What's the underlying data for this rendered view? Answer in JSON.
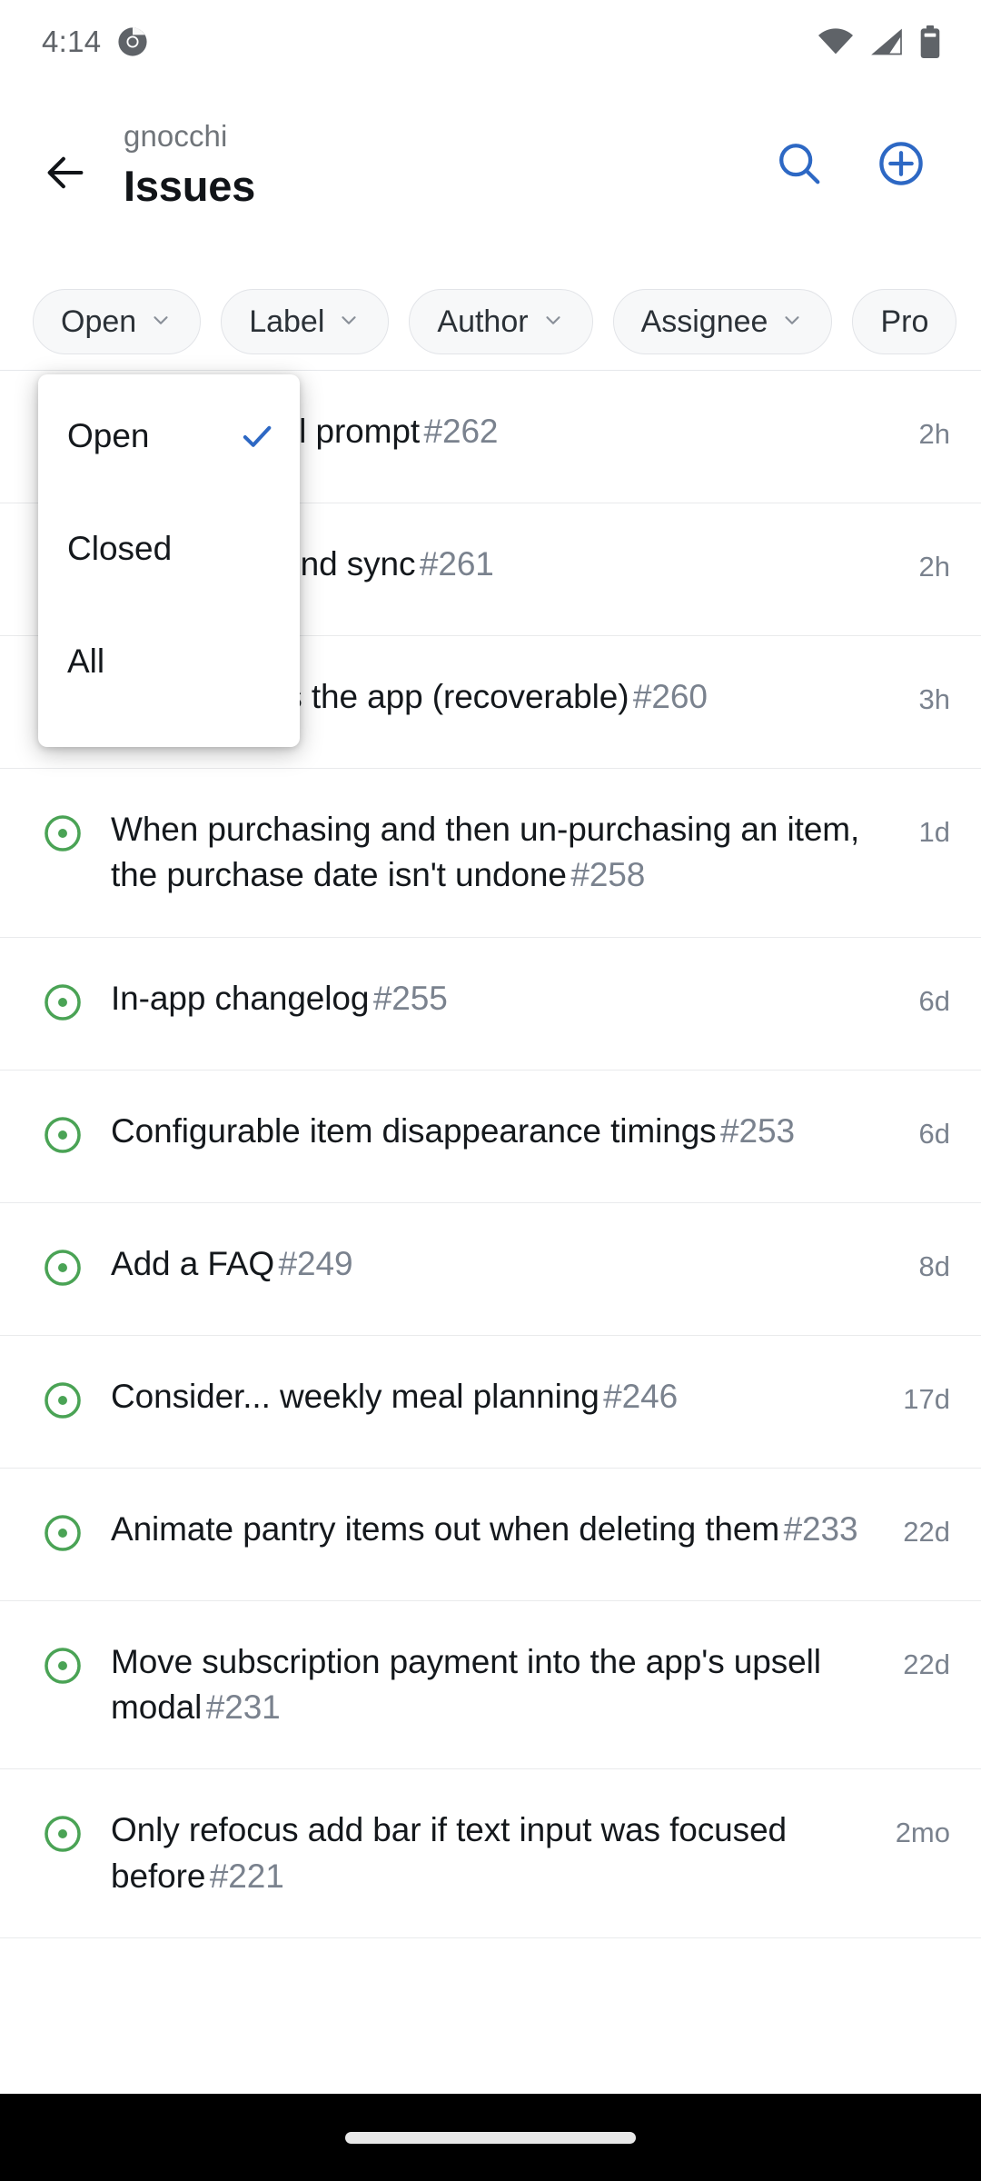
{
  "status_bar": {
    "time": "4:14",
    "browser_icon": "chrome-icon",
    "wifi_icon": "wifi-icon",
    "signal_icon": "cellular-signal-icon",
    "battery_icon": "battery-icon"
  },
  "app_bar": {
    "back_icon": "back-arrow-icon",
    "subtitle": "gnocchi",
    "title": "Issues",
    "search_icon": "search-icon",
    "add_icon": "plus-circle-icon"
  },
  "filters": [
    {
      "label": "Open",
      "chevron": "chevron-down-icon"
    },
    {
      "label": "Label",
      "chevron": "chevron-down-icon"
    },
    {
      "label": "Author",
      "chevron": "chevron-down-icon"
    },
    {
      "label": "Assignee",
      "chevron": "chevron-down-icon"
    },
    {
      "label": "Pro",
      "chevron": "chevron-down-icon"
    }
  ],
  "dropdown": {
    "open": true,
    "check_icon": "check-icon",
    "items": [
      {
        "label": "Open",
        "selected": true
      },
      {
        "label": "Closed",
        "selected": false
      },
      {
        "label": "All",
        "selected": false
      }
    ]
  },
  "issues": [
    {
      "icon": "issue-open-icon",
      "title": "e PWA install prompt",
      "number": "#262",
      "time": "2h",
      "obscured": true
    },
    {
      "icon": "issue-open-icon",
      "title": "dic background sync",
      "number": "#261",
      "time": "2h",
      "obscured": true
    },
    {
      "icon": "issue-open-icon",
      "title": "food crashes the app (recoverable)",
      "number": "#260",
      "time": "3h",
      "obscured": true
    },
    {
      "icon": "issue-open-icon",
      "title": "When purchasing and then un-purchasing an item, the purchase date isn't undone",
      "number": "#258",
      "time": "1d",
      "obscured": false
    },
    {
      "icon": "issue-open-icon",
      "title": "In-app changelog",
      "number": "#255",
      "time": "6d",
      "obscured": false
    },
    {
      "icon": "issue-open-icon",
      "title": "Configurable item disappearance timings",
      "number": "#253",
      "time": "6d",
      "obscured": false
    },
    {
      "icon": "issue-open-icon",
      "title": "Add a FAQ",
      "number": "#249",
      "time": "8d",
      "obscured": false
    },
    {
      "icon": "issue-open-icon",
      "title": "Consider... weekly meal planning",
      "number": "#246",
      "time": "17d",
      "obscured": false
    },
    {
      "icon": "issue-open-icon",
      "title": "Animate pantry items out when deleting them",
      "number": "#233",
      "time": "22d",
      "obscured": false
    },
    {
      "icon": "issue-open-icon",
      "title": "Move subscription payment into the app's upsell modal",
      "number": "#231",
      "time": "22d",
      "obscured": false
    },
    {
      "icon": "issue-open-icon",
      "title": "Only refocus add bar if text input was focused before",
      "number": "#221",
      "time": "2mo",
      "obscured": false
    }
  ],
  "nav_bar": {
    "home_handle": "gesture-pill"
  },
  "colors": {
    "accent_blue": "#2d68c4",
    "issue_open_green": "#4aa355",
    "text_primary": "#14181c",
    "text_muted": "#7a828e",
    "chip_bg": "#f7f8f9",
    "divider": "#e9eaec"
  }
}
